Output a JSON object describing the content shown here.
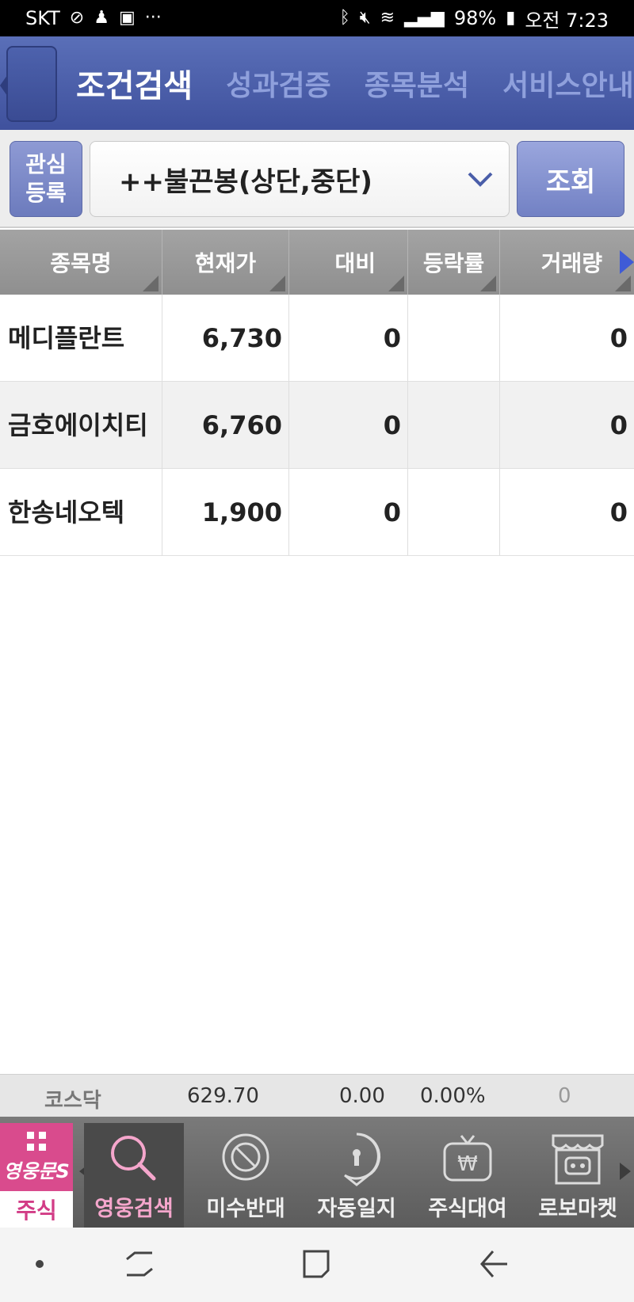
{
  "status_bar": {
    "carrier": "SKT",
    "battery": "98%",
    "time": "오전 7:23"
  },
  "header": {
    "tabs": [
      {
        "label": "조건검색",
        "active": true
      },
      {
        "label": "성과검증",
        "active": false
      },
      {
        "label": "종목분석",
        "active": false
      },
      {
        "label": "서비스안내",
        "active": false
      }
    ]
  },
  "search": {
    "interest_button_line1": "관심",
    "interest_button_line2": "등록",
    "condition_value": "++불끈봉(상단,중단)",
    "query_button": "조회"
  },
  "table": {
    "headers": [
      "종목명",
      "현재가",
      "대비",
      "등락률",
      "거래량"
    ],
    "rows": [
      {
        "name": "메디플란트",
        "price": "6,730",
        "change": "0",
        "rate": "",
        "volume": "0"
      },
      {
        "name": "금호에이치티",
        "price": "6,760",
        "change": "0",
        "rate": "",
        "volume": "0"
      },
      {
        "name": "한송네오텍",
        "price": "1,900",
        "change": "0",
        "rate": "",
        "volume": "0"
      }
    ]
  },
  "index_bar": {
    "name": "코스닥",
    "value": "629.70",
    "change": "0.00",
    "rate": "0.00%",
    "volume": "0"
  },
  "bottom_menu": {
    "brand_text": "영웅문S",
    "brand_label": "주식",
    "items": [
      {
        "label": "영웅검색",
        "icon": "search-icon"
      },
      {
        "label": "미수반대",
        "icon": "prohibit-icon"
      },
      {
        "label": "자동일지",
        "icon": "keyhole-bubble-icon"
      },
      {
        "label": "주식대여",
        "icon": "won-tv-icon"
      },
      {
        "label": "로보마켓",
        "icon": "robot-store-icon"
      }
    ]
  },
  "colors": {
    "header_blue": "#4a5ea9",
    "active_tab": "#ffffff",
    "inactive_tab": "#8fa0dc",
    "brand_pink": "#d94b8d",
    "active_menu_label": "#f5a6cc"
  }
}
